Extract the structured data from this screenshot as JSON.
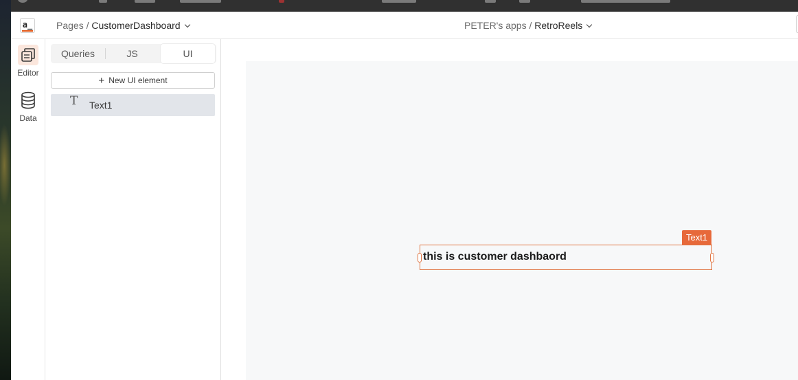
{
  "topbar": {
    "pages_prefix": "Pages /",
    "page_name": "CustomerDashboard",
    "workspace_prefix": "PETER's apps /",
    "app_name": "RetroReels",
    "logo_text": "a_"
  },
  "rail": {
    "items": [
      {
        "label": "Editor",
        "icon": "editor-icon",
        "active": true
      },
      {
        "label": "Data",
        "icon": "database-icon",
        "active": false
      }
    ]
  },
  "panel": {
    "tabs": [
      {
        "label": "Queries",
        "active": false
      },
      {
        "label": "JS",
        "active": false
      },
      {
        "label": "UI",
        "active": true
      }
    ],
    "new_button_label": "New UI element",
    "widgets": [
      {
        "label": "Text1",
        "icon": "text-widget-icon"
      }
    ]
  },
  "canvas": {
    "selected_widget_tag": "Text1",
    "text_widget_content": "this is customer dashbaord"
  },
  "colors": {
    "accent": "#e15615",
    "selection_border": "#e0733f",
    "canvas_bg": "#f7f8f9",
    "active_rail_bg": "#fbe6dc",
    "selected_row_bg": "#e2e5ea"
  }
}
